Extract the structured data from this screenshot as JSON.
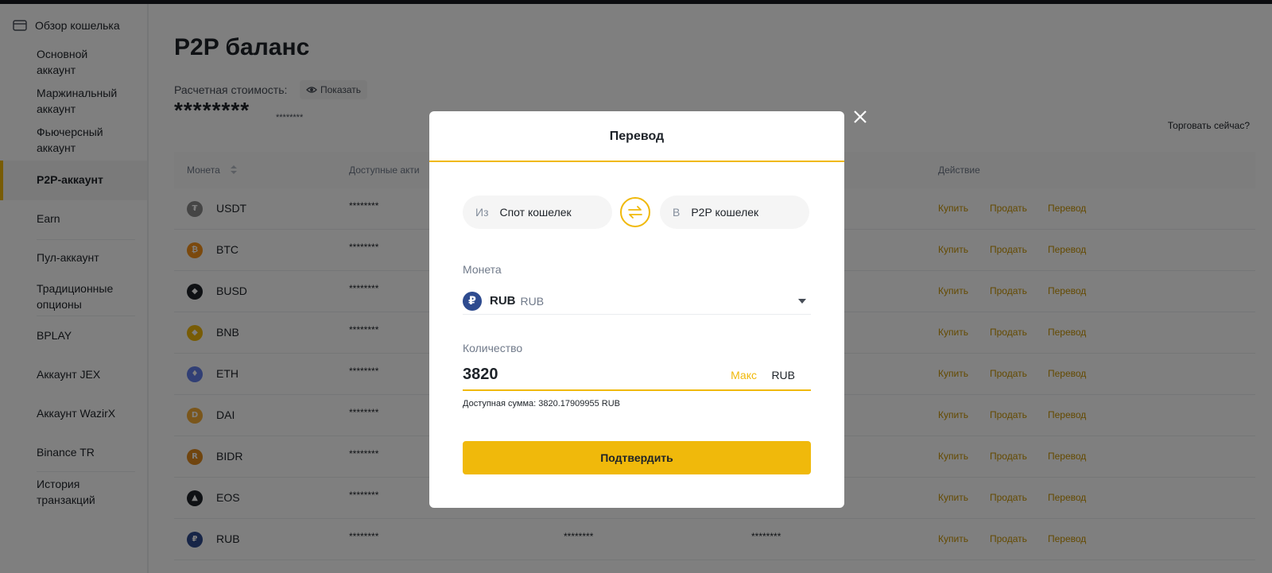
{
  "sidebar": {
    "overview": "Обзор кошелька",
    "items": [
      {
        "lines": [
          "Основной",
          "аккаунт"
        ]
      },
      {
        "lines": [
          "Маржинальный",
          "аккаунт"
        ]
      },
      {
        "lines": [
          "Фьючерсный",
          "аккаунт"
        ]
      },
      {
        "lines": [
          "P2P-аккаунт"
        ]
      },
      {
        "lines": [
          "Earn"
        ]
      },
      {
        "lines": [
          "Пул-аккаунт"
        ]
      },
      {
        "lines": [
          "Традиционные",
          "опционы"
        ]
      },
      {
        "lines": [
          "BPLAY"
        ]
      },
      {
        "lines": [
          "Аккаунт JEX"
        ]
      },
      {
        "lines": [
          "Аккаунт WazirX"
        ]
      },
      {
        "lines": [
          "Binance TR"
        ]
      },
      {
        "lines": [
          "История",
          "транзакций"
        ]
      }
    ]
  },
  "page": {
    "title": "P2P баланс",
    "estimated_label": "Расчетная стоимость:",
    "show_label": "Показать",
    "mask_big": "********",
    "mask_small": "********",
    "trade_now": "Торговать сейчас?"
  },
  "table": {
    "headers": {
      "coin": "Монета",
      "available": "Доступные акти",
      "action": "Действие"
    },
    "action_labels": {
      "buy": "Купить",
      "sell": "Продать",
      "transfer": "Перевод"
    },
    "rows": [
      {
        "coin": "USDT",
        "icon": "usdt-icon",
        "color": "#8a8a8a",
        "glyph": "₮",
        "available": "********"
      },
      {
        "coin": "BTC",
        "icon": "btc-icon",
        "color": "#f7931a",
        "glyph": "₿",
        "available": "********"
      },
      {
        "coin": "BUSD",
        "icon": "busd-icon",
        "color": "#1e2329",
        "glyph": "◆",
        "available": "********"
      },
      {
        "coin": "BNB",
        "icon": "bnb-icon",
        "color": "#f0b90b",
        "glyph": "◆",
        "available": "********"
      },
      {
        "coin": "ETH",
        "icon": "eth-icon",
        "color": "#627eea",
        "glyph": "♦",
        "available": "********"
      },
      {
        "coin": "DAI",
        "icon": "dai-icon",
        "color": "#f5ac37",
        "glyph": "D",
        "available": "********"
      },
      {
        "coin": "BIDR",
        "icon": "bidr-icon",
        "color": "#e08a1e",
        "glyph": "R",
        "available": "********"
      },
      {
        "coin": "EOS",
        "icon": "eos-icon",
        "color": "#1e2329",
        "glyph": "▲",
        "available": "********"
      },
      {
        "coin": "RUB",
        "icon": "rub-icon",
        "color": "#2e4b8f",
        "glyph": "₽",
        "available": "********",
        "col3": "********",
        "col4": "********"
      }
    ]
  },
  "modal": {
    "title": "Перевод",
    "from_label": "Из",
    "from_value": "Спот кошелек",
    "to_label": "В",
    "to_value": "P2P кошелек",
    "coin_label": "Монета",
    "coin_code": "RUB",
    "coin_sub": "RUB",
    "amount_label": "Количество",
    "amount_value": "3820",
    "max_label": "Макс",
    "amount_unit": "RUB",
    "available_text": "Доступная сумма: 3820.17909955 RUB",
    "confirm_label": "Подтвердить"
  },
  "colors": {
    "accent": "#f0b90b",
    "text": "#1e2329",
    "muted": "#707a8a"
  }
}
